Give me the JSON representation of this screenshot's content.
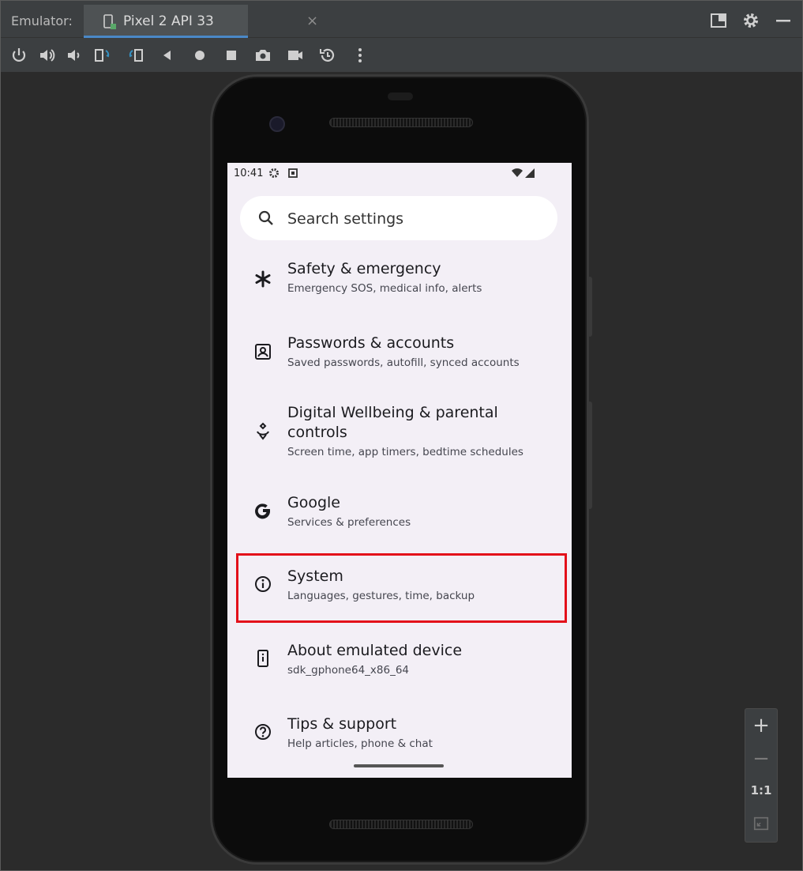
{
  "titlebar": {
    "label": "Emulator:",
    "tab_label": "Pixel 2 API 33",
    "close_glyph": "×",
    "right_icons": [
      "restore-layout-icon",
      "gear-icon",
      "minimize-icon"
    ]
  },
  "toolbar": {
    "icons": [
      "power-icon",
      "volume-up-icon",
      "volume-down-icon",
      "rotate-left-icon",
      "rotate-right-icon",
      "back-icon",
      "home-icon",
      "overview-icon",
      "camera-icon",
      "record-icon",
      "snapshot-icon",
      "more-icon"
    ]
  },
  "status": {
    "time": "10:41"
  },
  "search": {
    "placeholder": "Search settings"
  },
  "settings": [
    {
      "title": "Safety & emergency",
      "subtitle": "Emergency SOS, medical info, alerts",
      "icon": "asterisk-icon"
    },
    {
      "title": "Passwords & accounts",
      "subtitle": "Saved passwords, autofill, synced accounts",
      "icon": "account-box-icon"
    },
    {
      "title": "Digital Wellbeing & parental controls",
      "subtitle": "Screen time, app timers, bedtime schedules",
      "icon": "wellbeing-icon"
    },
    {
      "title": "Google",
      "subtitle": "Services & preferences",
      "icon": "google-icon"
    },
    {
      "title": "System",
      "subtitle": "Languages, gestures, time, backup",
      "icon": "info-icon"
    },
    {
      "title": "About emulated device",
      "subtitle": "sdk_gphone64_x86_64",
      "icon": "device-info-icon"
    },
    {
      "title": "Tips & support",
      "subtitle": "Help articles, phone & chat",
      "icon": "help-icon"
    }
  ],
  "zoom": {
    "plus": "+",
    "minus": "−",
    "actual": "1:1"
  },
  "colors": {
    "highlight": "#e3101a",
    "screen_bg": "#f3eff6",
    "ide_bg": "#2b2b2b"
  }
}
